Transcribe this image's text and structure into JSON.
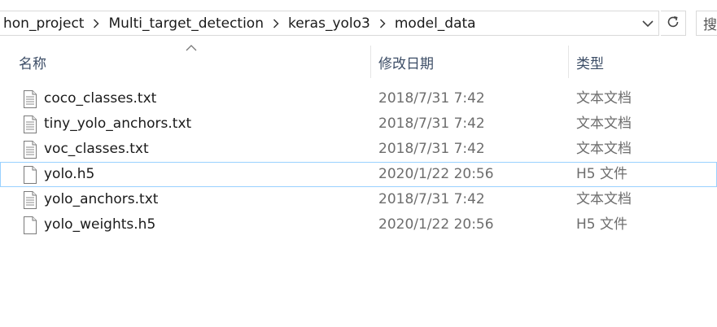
{
  "breadcrumb": {
    "segments": [
      "hon_project",
      "Multi_target_detection",
      "keras_yolo3",
      "model_data"
    ]
  },
  "search": {
    "partial_label": "搜"
  },
  "columns": {
    "name": "名称",
    "date": "修改日期",
    "type": "类型"
  },
  "files": [
    {
      "name": "coco_classes.txt",
      "date": "2018/7/31 7:42",
      "type": "文本文档",
      "icon": "text-file-icon"
    },
    {
      "name": "tiny_yolo_anchors.txt",
      "date": "2018/7/31 7:42",
      "type": "文本文档",
      "icon": "text-file-icon"
    },
    {
      "name": "voc_classes.txt",
      "date": "2018/7/31 7:42",
      "type": "文本文档",
      "icon": "text-file-icon"
    },
    {
      "name": "yolo.h5",
      "date": "2020/1/22 20:56",
      "type": "H5 文件",
      "icon": "blank-file-icon"
    },
    {
      "name": "yolo_anchors.txt",
      "date": "2018/7/31 7:42",
      "type": "文本文档",
      "icon": "text-file-icon"
    },
    {
      "name": "yolo_weights.h5",
      "date": "2020/1/22 20:56",
      "type": "H5 文件",
      "icon": "blank-file-icon"
    }
  ],
  "colors": {
    "focus_border": "#99d1ff",
    "header_text": "#3c4d66",
    "secondary_text": "#6d6d6d"
  }
}
